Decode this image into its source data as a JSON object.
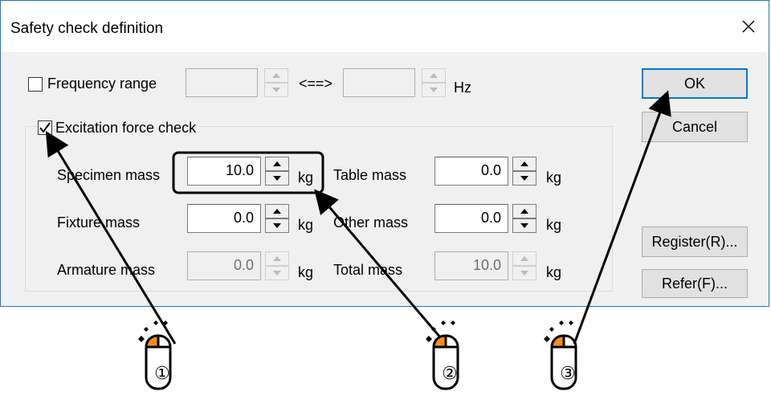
{
  "dialog": {
    "title": "Safety check definition",
    "frequency_range": {
      "checkbox_label": "Frequency range",
      "checked": false,
      "from_value": "",
      "separator": "<==>",
      "to_value": "",
      "unit": "Hz"
    },
    "excitation": {
      "checkbox_label": "Excitation force check",
      "checked": true,
      "fields": [
        {
          "label": "Specimen mass",
          "value": "10.0",
          "unit": "kg",
          "enabled": true
        },
        {
          "label": "Table mass",
          "value": "0.0",
          "unit": "kg",
          "enabled": true
        },
        {
          "label": "Fixture  mass",
          "value": "0.0",
          "unit": "kg",
          "enabled": true
        },
        {
          "label": "Other mass",
          "value": "0.0",
          "unit": "kg",
          "enabled": true
        },
        {
          "label": "Armature mass",
          "value": "0.0",
          "unit": "kg",
          "enabled": false
        },
        {
          "label": "Total mass",
          "value": "10.0",
          "unit": "kg",
          "enabled": false
        }
      ]
    },
    "buttons": {
      "ok": "OK",
      "cancel": "Cancel",
      "register": "Register(R)...",
      "refer": "Refer(F)..."
    }
  },
  "callouts": {
    "markers": [
      "①",
      "②",
      "③"
    ],
    "colors": {
      "accent": "#ff8c1a",
      "arrow": "#000000",
      "dialog_border": "#1979ca",
      "default_button": "#0078d7"
    }
  }
}
